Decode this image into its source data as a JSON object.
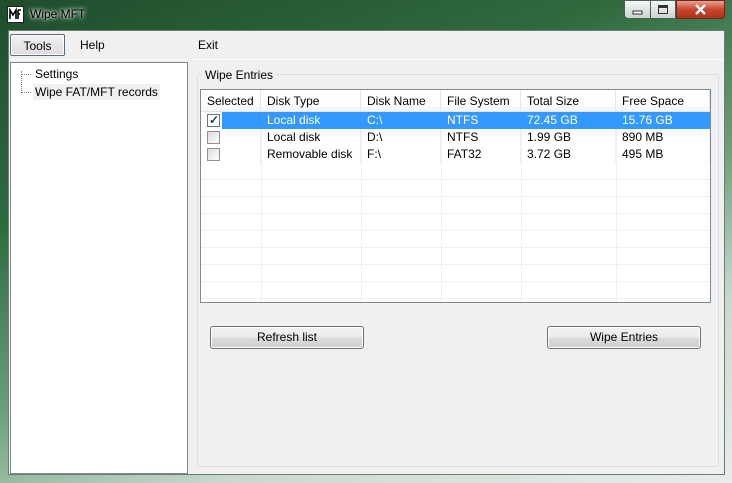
{
  "window": {
    "title": "Wipe MFT"
  },
  "menu": {
    "tools": "Tools",
    "help": "Help",
    "exit": "Exit"
  },
  "tree": {
    "items": [
      "Settings",
      "Wipe FAT/MFT records"
    ]
  },
  "group": {
    "label": "Wipe Entries"
  },
  "table": {
    "columns": [
      "Selected",
      "Disk Type",
      "Disk Name",
      "File System",
      "Total Size",
      "Free Space"
    ],
    "rows": [
      {
        "selected": true,
        "disk_type": "Local disk",
        "disk_name": "C:\\",
        "file_system": "NTFS",
        "total_size": "72.45 GB",
        "free_space": "15.76 GB"
      },
      {
        "selected": false,
        "disk_type": "Local disk",
        "disk_name": "D:\\",
        "file_system": "NTFS",
        "total_size": "1.99 GB",
        "free_space": "890 MB"
      },
      {
        "selected": false,
        "disk_type": "Removable disk",
        "disk_name": "F:\\",
        "file_system": "FAT32",
        "total_size": "3.72 GB",
        "free_space": "495 MB"
      }
    ],
    "highlighted_row": 0
  },
  "buttons": {
    "refresh": "Refresh list",
    "wipe": "Wipe Entries"
  },
  "colors": {
    "selection": "#3399ff",
    "close_button": "#c9462c"
  }
}
